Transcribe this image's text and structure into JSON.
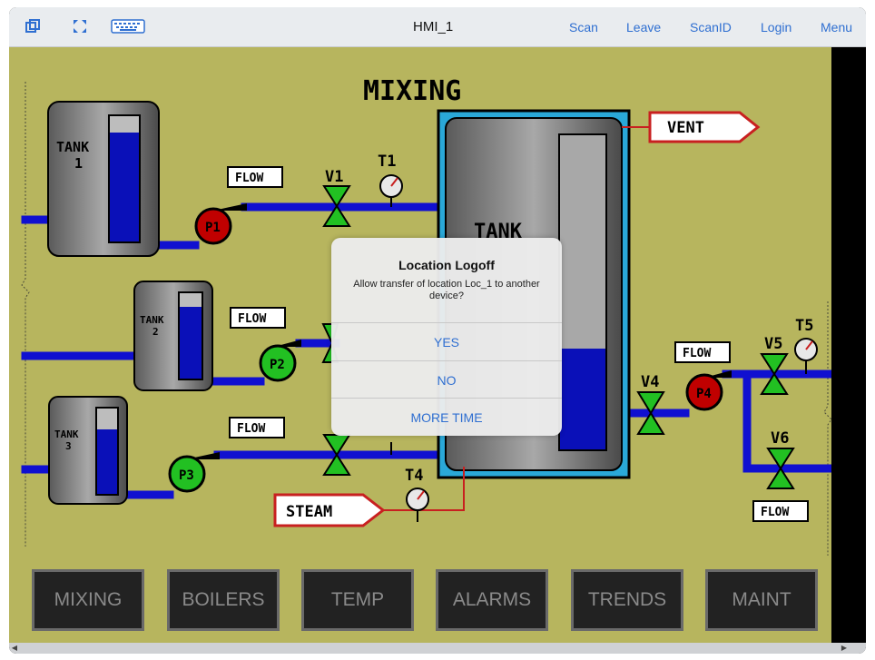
{
  "topbar": {
    "title": "HMI_1",
    "links": [
      "Scan",
      "Leave",
      "ScanID",
      "Login",
      "Menu"
    ]
  },
  "screen": {
    "title": "MIXING",
    "labels": {
      "tank1a": "TANK",
      "tank1b": "1",
      "tank2a": "TANK",
      "tank2b": "2",
      "tank3a": "TANK",
      "tank3b": "3",
      "tank_main": "TANK",
      "vent": "VENT",
      "steam": "STEAM",
      "flow": "FLOW",
      "v1": "V1",
      "v4": "V4",
      "v5": "V5",
      "v6": "V6",
      "t1": "T1",
      "t4": "T4",
      "t5": "T5",
      "p1": "P1",
      "p2": "P2",
      "p3": "P3",
      "p4": "P4"
    },
    "levels": {
      "tank1": 0.87,
      "tank2": 0.84,
      "tank3": 0.76,
      "tank_main": 0.32
    },
    "colors": {
      "background": "#b7b55e",
      "pipe": "#1010d0",
      "pump_red": "#c00000",
      "pump_green": "#22c022",
      "valve": "#22c022",
      "alarm_line": "#c82020"
    }
  },
  "nav": [
    "MIXING",
    "BOILERS",
    "TEMP",
    "ALARMS",
    "TRENDS",
    "MAINT"
  ],
  "dialog": {
    "title": "Location Logoff",
    "message": "Allow transfer of location Loc_1 to another device?",
    "buttons": [
      "YES",
      "NO",
      "MORE TIME"
    ]
  }
}
